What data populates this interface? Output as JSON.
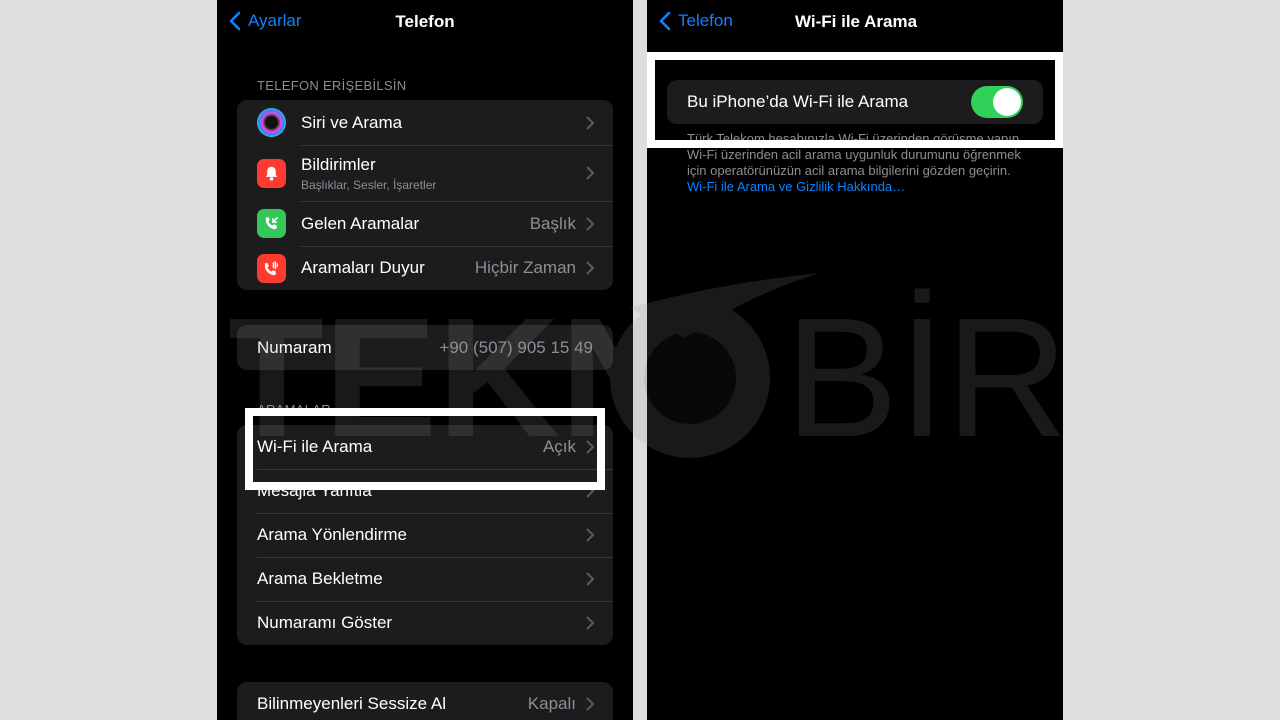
{
  "left": {
    "nav": {
      "back_label": "Ayarlar",
      "title": "Telefon"
    },
    "section_access": "TELEFON ERİŞEBİLSİN",
    "access_items": [
      {
        "label": "Siri ve Arama",
        "icon": "siri-icon"
      },
      {
        "label": "Bildirimler",
        "sublabel": "Başlıklar, Sesler, İşaretler",
        "icon": "bell-icon",
        "icon_color": "#ff3b30"
      },
      {
        "label": "Gelen Aramalar",
        "value": "Başlık",
        "icon": "incoming-call-icon",
        "icon_color": "#34c759"
      },
      {
        "label": "Aramaları Duyur",
        "value": "Hiçbir Zaman",
        "icon": "announce-calls-icon",
        "icon_color": "#ff3b30"
      }
    ],
    "number": {
      "label": "Numaram",
      "value": "+90 (507) 905 15 49"
    },
    "section_calls": "ARAMALAR",
    "call_items": [
      {
        "label": "Wi-Fi ile Arama",
        "value": "Açık"
      },
      {
        "label": "Mesajla Yanıtla"
      },
      {
        "label": "Arama Yönlendirme"
      },
      {
        "label": "Arama Bekletme"
      },
      {
        "label": "Numaramı Göster"
      }
    ],
    "silence": {
      "label": "Bilinmeyenleri Sessize Al",
      "value": "Kapalı"
    }
  },
  "right": {
    "nav": {
      "back_label": "Telefon",
      "title": "Wi-Fi ile Arama"
    },
    "toggle": {
      "label": "Bu iPhone’da Wi-Fi ile Arama",
      "on": true
    },
    "footnote_text": "Türk Telekom hesabınızla Wi-Fi üzerinden görüşme yapın. Wi-Fi üzerinden acil arama uygunluk durumunu öğrenmek için operatörünüzün acil arama bilgilerini gözden geçirin. ",
    "footnote_link": "Wi-Fi ile Arama ve Gizlilik Hakkında…"
  },
  "watermark": {
    "left_text": "TEKN",
    "right_text": "BİRD"
  },
  "colors": {
    "accent": "#0a84ff",
    "toggle_on": "#30d158",
    "highlight": "#ffffff"
  }
}
